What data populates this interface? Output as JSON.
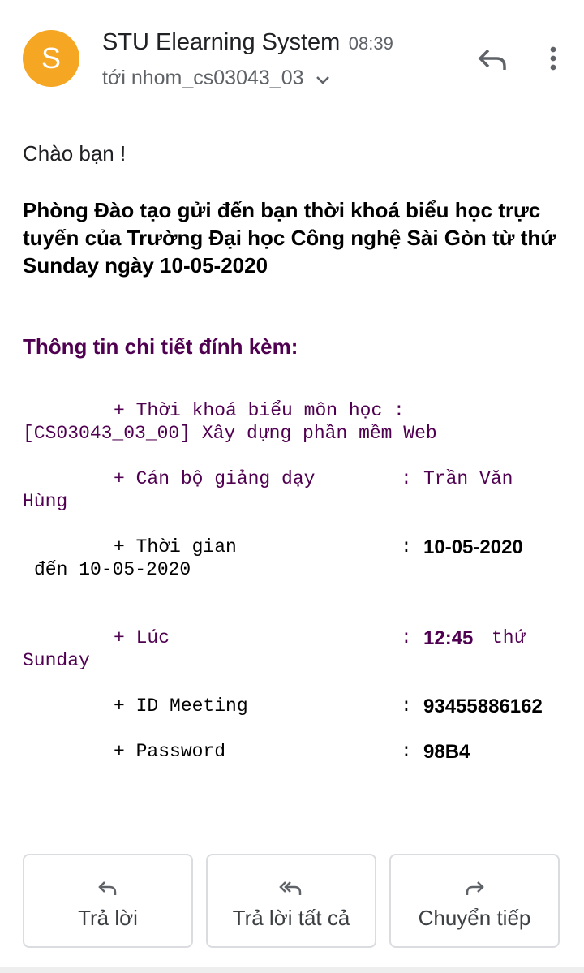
{
  "header": {
    "avatar_letter": "S",
    "avatar_color": "#f5a623",
    "sender": "STU Elearning System",
    "time": "08:39",
    "recipient": "tới nhom_cs03043_03",
    "icons": [
      "chevron-down-icon",
      "reply-icon",
      "more-vert-icon"
    ]
  },
  "body": {
    "greeting": "Chào bạn !",
    "intro": "Phòng Đào tạo gửi đến bạn thời khoá biểu học trực tuyến của Trường Đại học Công nghệ Sài Gòn từ thứ Sunday ngày 10-05-2020",
    "details_heading": "Thông tin chi tiết đính kèm:",
    "heading_color": "#500050",
    "course": {
      "label": "+ Thời khoá biểu môn học :",
      "value": "[CS03043_03_00] Xây dựng phần mềm Web"
    },
    "lecturer": {
      "label": "+ Cán bộ giảng dạy",
      "colon": ":",
      "value_part1": "Trần Văn",
      "value_part2": "Hùng"
    },
    "period": {
      "label": "+ Thời gian",
      "colon": ":",
      "value_bold": "10-05-2020",
      "value_rest": "đến 10-05-2020"
    },
    "at": {
      "label": "+ Lúc",
      "colon": ":",
      "value_bold": "12:45",
      "value_part2": "thứ",
      "value_part3": "Sunday"
    },
    "meeting_id": {
      "label": "+ ID Meeting",
      "colon": ":",
      "value": "93455886162"
    },
    "password": {
      "label": "+ Password",
      "colon": ":",
      "value": "98B4"
    }
  },
  "actions": {
    "reply": "Trả lời",
    "reply_all": "Trả lời tất cả",
    "forward": "Chuyển tiếp"
  }
}
